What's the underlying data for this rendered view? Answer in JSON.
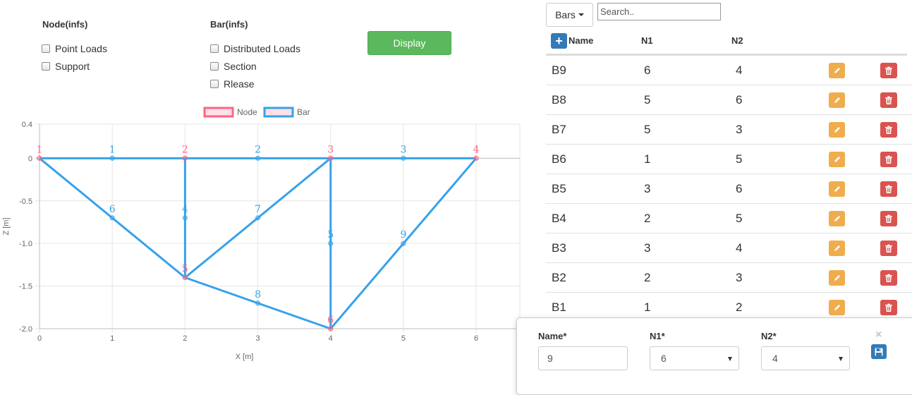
{
  "filters": {
    "node_group": {
      "title": "Node(infs)",
      "options": [
        {
          "label": "Point Loads",
          "checked": false
        },
        {
          "label": "Support",
          "checked": false
        }
      ]
    },
    "bar_group": {
      "title": "Bar(infs)",
      "options": [
        {
          "label": "Distributed Loads",
          "checked": false
        },
        {
          "label": "Section",
          "checked": false
        },
        {
          "label": "Rlease",
          "checked": false
        }
      ]
    },
    "display_button": "Display"
  },
  "chart_data": {
    "type": "scatter",
    "xlabel": "X [m]",
    "ylabel": "Z [m]",
    "xlim": [
      0,
      6.6
    ],
    "ylim": [
      -2.0,
      0.4
    ],
    "x_ticks": [
      "0",
      "1",
      "2",
      "3",
      "4",
      "5",
      "6"
    ],
    "y_ticks": [
      "0.4",
      "0",
      "-0.5",
      "-1.0",
      "-1.5",
      "-2.0"
    ],
    "grid": true,
    "legend": {
      "placement": "top-center",
      "entries": [
        {
          "name": "Node",
          "color": "#ff6384"
        },
        {
          "name": "Bar",
          "color": "#36a2eb"
        }
      ]
    },
    "nodes": [
      {
        "label": "1",
        "x": 0,
        "z": 0
      },
      {
        "label": "2",
        "x": 2,
        "z": 0
      },
      {
        "label": "3",
        "x": 4,
        "z": 0
      },
      {
        "label": "4",
        "x": 6,
        "z": 0
      },
      {
        "label": "5",
        "x": 2,
        "z": -1.4
      },
      {
        "label": "6",
        "x": 4,
        "z": -2.0
      }
    ],
    "bars": [
      {
        "name": "B1",
        "n1": "1",
        "n2": "2",
        "mid_label": "1",
        "mid": [
          1,
          0
        ]
      },
      {
        "name": "B2",
        "n1": "2",
        "n2": "3",
        "mid_label": "2",
        "mid": [
          3,
          0
        ]
      },
      {
        "name": "B3",
        "n1": "3",
        "n2": "4",
        "mid_label": "3",
        "mid": [
          5,
          0
        ]
      },
      {
        "name": "B4",
        "n1": "2",
        "n2": "5",
        "mid_label": "4",
        "mid": [
          2,
          -0.7
        ]
      },
      {
        "name": "B5",
        "n1": "3",
        "n2": "6",
        "mid_label": "5",
        "mid": [
          4,
          -1.0
        ]
      },
      {
        "name": "B6",
        "n1": "1",
        "n2": "5",
        "mid_label": "6",
        "mid": [
          1,
          -0.7
        ]
      },
      {
        "name": "B7",
        "n1": "5",
        "n2": "3",
        "mid_label": "7",
        "mid": [
          3,
          -0.7
        ]
      },
      {
        "name": "B8",
        "n1": "5",
        "n2": "6",
        "mid_label": "8",
        "mid": [
          3,
          -1.7
        ]
      },
      {
        "name": "B9",
        "n1": "6",
        "n2": "4",
        "mid_label": "9",
        "mid": [
          5,
          -1.0
        ]
      }
    ]
  },
  "table": {
    "dropdown_label": "Bars",
    "search_placeholder": "Search..",
    "add_icon": "plus-icon",
    "headers": {
      "name": "Name",
      "n1": "N1",
      "n2": "N2"
    },
    "rows": [
      {
        "name": "B9",
        "n1": "6",
        "n2": "4"
      },
      {
        "name": "B8",
        "n1": "5",
        "n2": "6"
      },
      {
        "name": "B7",
        "n1": "5",
        "n2": "3"
      },
      {
        "name": "B6",
        "n1": "1",
        "n2": "5"
      },
      {
        "name": "B5",
        "n1": "3",
        "n2": "6"
      },
      {
        "name": "B4",
        "n1": "2",
        "n2": "5"
      },
      {
        "name": "B3",
        "n1": "3",
        "n2": "4"
      },
      {
        "name": "B2",
        "n1": "2",
        "n2": "3"
      },
      {
        "name": "B1",
        "n1": "1",
        "n2": "2"
      }
    ],
    "edit_icon": "pencil-icon",
    "delete_icon": "trash-icon"
  },
  "edit_form": {
    "name_label": "Name*",
    "name_value": "9",
    "n1_label": "N1*",
    "n1_value": "6",
    "n2_label": "N2*",
    "n2_value": "4",
    "close_glyph": "×",
    "save_icon": "floppy-disk-icon"
  },
  "colors": {
    "node": "#ff6384",
    "bar": "#36a2eb",
    "success": "#5cb85c",
    "primary": "#337ab7",
    "warning": "#f0ad4e",
    "danger": "#d9534f"
  }
}
